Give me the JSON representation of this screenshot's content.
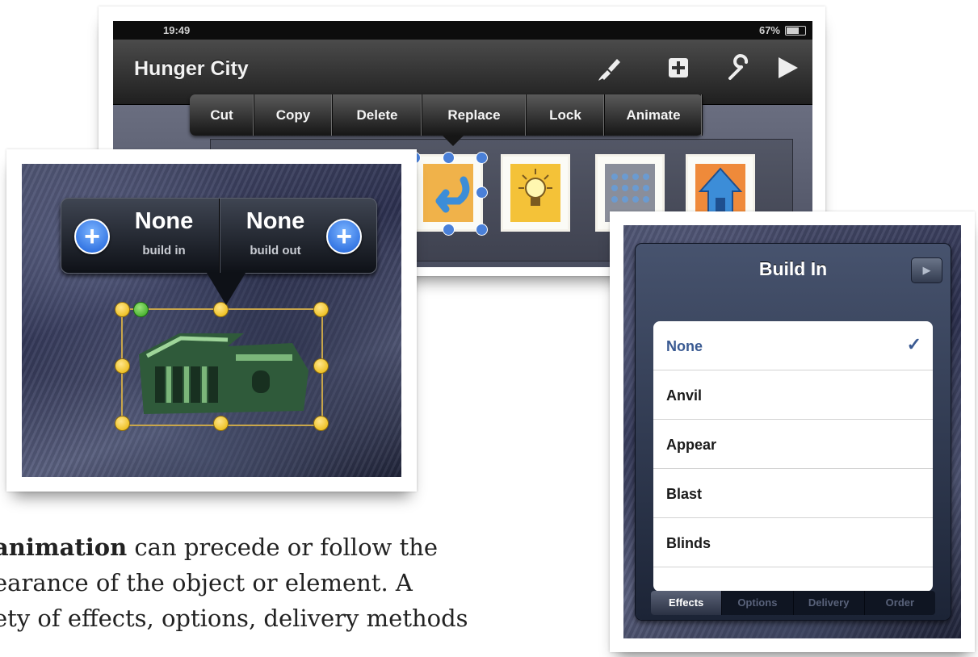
{
  "toolbar_screen": {
    "status_time": "19:49",
    "status_battery": "67%",
    "title": "Hunger City",
    "nav_icons": [
      "brush-icon",
      "add-icon",
      "wrench-icon",
      "play-icon"
    ],
    "menu_items": [
      "Cut",
      "Copy",
      "Delete",
      "Replace",
      "Lock",
      "Animate"
    ]
  },
  "build_popover": {
    "in_value": "None",
    "in_label": "build in",
    "out_value": "None",
    "out_label": "build out"
  },
  "build_panel": {
    "title": "Build In",
    "effects": [
      "None",
      "Anvil",
      "Appear",
      "Blast",
      "Blinds"
    ],
    "selected": "None",
    "tabs": [
      "Effects",
      "Options",
      "Delivery",
      "Order"
    ],
    "active_tab": "Effects"
  },
  "caption": {
    "bold_word": "animation",
    "line1_rest": " can precede or follow the",
    "line2": "earance of the object or element.  A",
    "line3": "ety of effects, options, delivery methods"
  },
  "colors": {
    "selection_blue": "#4a80d8",
    "selection_yellow": "#e8b400",
    "check_blue": "#3a5a92"
  }
}
